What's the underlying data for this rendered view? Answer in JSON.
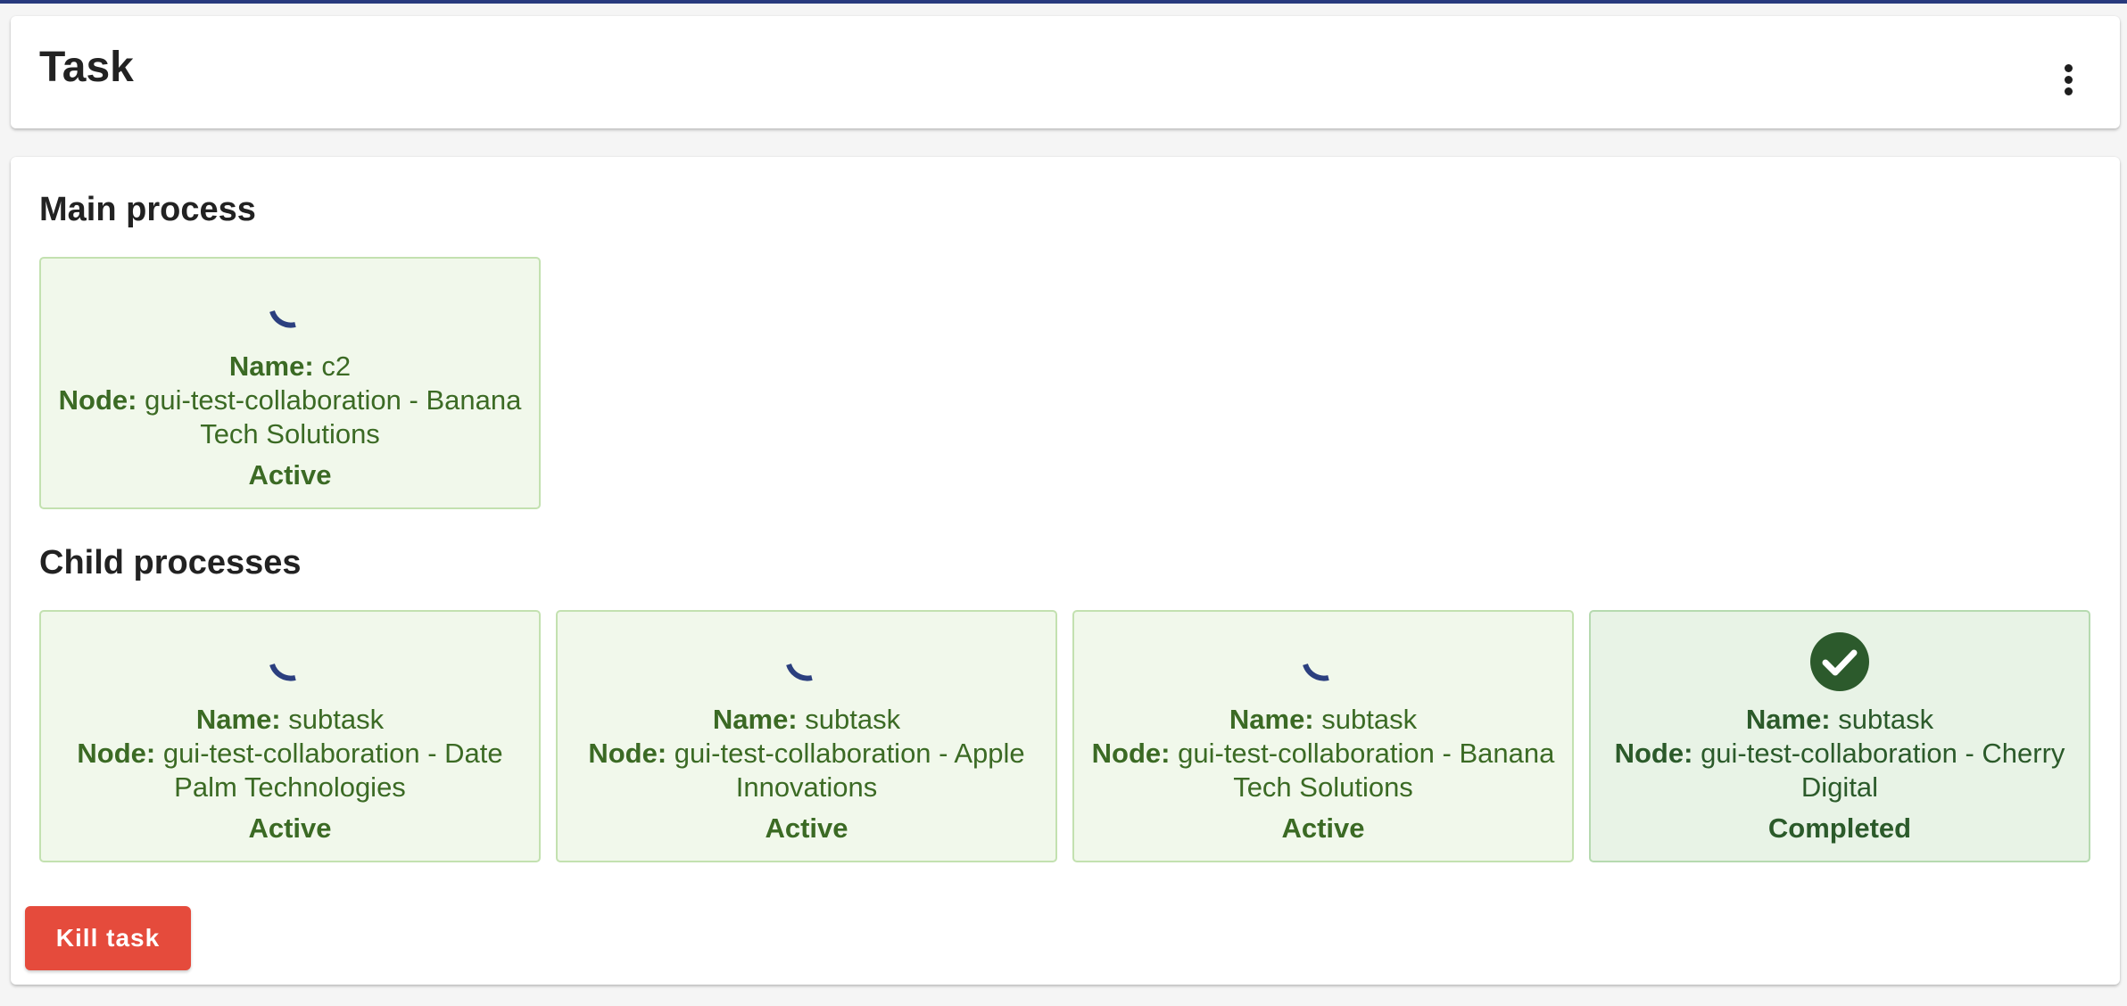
{
  "header": {
    "title": "Task",
    "menu_icon": "more-vertical-icon"
  },
  "main_process": {
    "title": "Main process",
    "card": {
      "name_label": "Name:",
      "name": "c2",
      "node_label": "Node:",
      "node": "gui-test-collaboration - Banana Tech Solutions",
      "status": "Active",
      "icon": "spinner-icon"
    }
  },
  "child_processes": {
    "title": "Child processes",
    "cards": [
      {
        "name_label": "Name:",
        "name": "subtask",
        "node_label": "Node:",
        "node": "gui-test-collaboration - Date Palm Technologies",
        "status": "Active",
        "icon": "spinner-icon"
      },
      {
        "name_label": "Name:",
        "name": "subtask",
        "node_label": "Node:",
        "node": "gui-test-collaboration - Apple Innovations",
        "status": "Active",
        "icon": "spinner-icon"
      },
      {
        "name_label": "Name:",
        "name": "subtask",
        "node_label": "Node:",
        "node": "gui-test-collaboration - Banana Tech Solutions",
        "status": "Active",
        "icon": "spinner-icon"
      },
      {
        "name_label": "Name:",
        "name": "subtask",
        "node_label": "Node:",
        "node": "gui-test-collaboration - Cherry Digital",
        "status": "Completed",
        "icon": "check-circle-icon"
      }
    ]
  },
  "actions": {
    "kill_label": "Kill task"
  },
  "colors": {
    "accent": "#283a7d",
    "danger": "#e54b3c",
    "active_text": "#3b6a24",
    "card_bg": "#f1f8eb",
    "card_border": "#c3e1b0",
    "completed_icon": "#2c5a2c"
  }
}
